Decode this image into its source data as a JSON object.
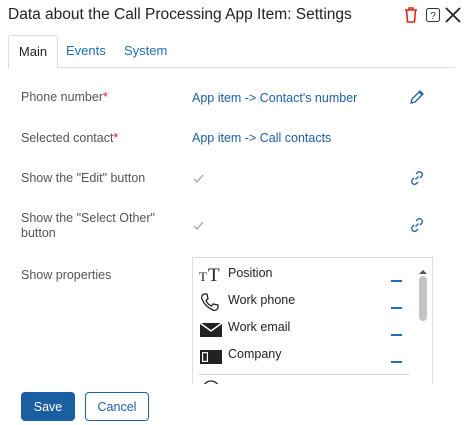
{
  "dialog": {
    "title": "Data about the Call Processing App Item: Settings"
  },
  "tabs": [
    {
      "label": "Main"
    },
    {
      "label": "Events"
    },
    {
      "label": "System"
    }
  ],
  "fields": {
    "phone": {
      "label": "Phone number",
      "required_mark": "*",
      "value": "App item -> Contact's number"
    },
    "contact": {
      "label": "Selected contact",
      "required_mark": "*",
      "value": "App item -> Call contacts"
    },
    "edit_btn": {
      "label": "Show the \"Edit\" button",
      "checked": true
    },
    "select_other": {
      "label_line1": "Show the \"Select Other\"",
      "label_line2": "button",
      "checked": true
    },
    "show_properties": {
      "label": "Show properties"
    }
  },
  "properties": [
    {
      "name": "Position",
      "icon": "text-type-icon"
    },
    {
      "name": "Work phone",
      "icon": "phone-icon"
    },
    {
      "name": "Work email",
      "icon": "envelope-icon"
    },
    {
      "name": "Company",
      "icon": "company-card-icon"
    }
  ],
  "buttons": {
    "save": "Save",
    "cancel": "Cancel"
  },
  "colors": {
    "accent": "#1b5fa3",
    "link": "#1c5fa8",
    "required": "#e1251b",
    "trash": "#e1251b"
  }
}
